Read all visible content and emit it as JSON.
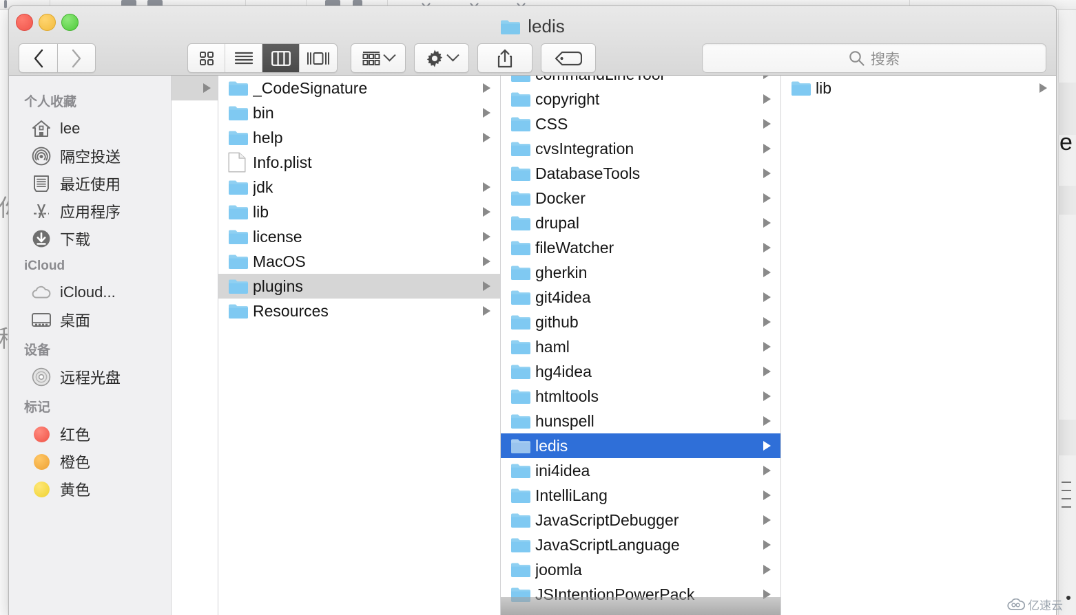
{
  "window": {
    "title": "ledis",
    "title_icon": "folder-icon",
    "traffic_lights": [
      {
        "name": "close",
        "color": "#f0554c"
      },
      {
        "name": "minimize",
        "color": "#f2bb3d"
      },
      {
        "name": "zoom",
        "color": "#4fc93b"
      }
    ]
  },
  "toolbar": {
    "back_label": "‹",
    "forward_label": "›",
    "view_modes": [
      {
        "name": "icon-view",
        "icon": "grid-icon",
        "active": false
      },
      {
        "name": "list-view",
        "icon": "list-icon",
        "active": false
      },
      {
        "name": "column-view",
        "icon": "columns-icon",
        "active": true
      },
      {
        "name": "gallery-view",
        "icon": "gallery-icon",
        "active": false
      }
    ],
    "arrange": {
      "icon": "arrange-icon",
      "chevron": "chevron-down-icon"
    },
    "action": {
      "icon": "gear-icon",
      "chevron": "chevron-down-icon"
    },
    "share": {
      "icon": "share-icon"
    },
    "tags": {
      "icon": "tag-icon"
    }
  },
  "search": {
    "icon": "search-icon",
    "placeholder": "搜索",
    "value": ""
  },
  "sidebar": {
    "sections": [
      {
        "header": "个人收藏",
        "items": [
          {
            "label": "lee",
            "icon": "home-icon"
          },
          {
            "label": "隔空投送",
            "icon": "airdrop-icon"
          },
          {
            "label": "最近使用",
            "icon": "recents-icon"
          },
          {
            "label": "应用程序",
            "icon": "applications-icon"
          },
          {
            "label": "下载",
            "icon": "downloads-icon"
          }
        ]
      },
      {
        "header": "iCloud",
        "items": [
          {
            "label": "iCloud...",
            "icon": "icloud-icon"
          },
          {
            "label": "桌面",
            "icon": "desktop-icon"
          }
        ]
      },
      {
        "header": "设备",
        "items": [
          {
            "label": "远程光盘",
            "icon": "remote-disc-icon"
          }
        ]
      },
      {
        "header": "标记",
        "items": [
          {
            "label": "红色",
            "icon": "tag-dot-icon",
            "color": "#f05a50"
          },
          {
            "label": "橙色",
            "icon": "tag-dot-icon",
            "color": "#f2a33c"
          },
          {
            "label": "黄色",
            "icon": "tag-dot-icon",
            "color": "#f2d23c"
          }
        ]
      }
    ]
  },
  "columns": [
    {
      "name": "column-ancestor",
      "partial": true,
      "items": [
        {
          "label": "",
          "kind": "folder",
          "selected": true,
          "has_children": true
        }
      ]
    },
    {
      "name": "column-app-contents",
      "items": [
        {
          "label": "_CodeSignature",
          "kind": "folder",
          "has_children": true,
          "selected": false
        },
        {
          "label": "bin",
          "kind": "folder",
          "has_children": true,
          "selected": false
        },
        {
          "label": "help",
          "kind": "folder",
          "has_children": true,
          "selected": false
        },
        {
          "label": "Info.plist",
          "kind": "file",
          "has_children": false,
          "selected": false
        },
        {
          "label": "jdk",
          "kind": "folder",
          "has_children": true,
          "selected": false
        },
        {
          "label": "lib",
          "kind": "folder",
          "has_children": true,
          "selected": false
        },
        {
          "label": "license",
          "kind": "folder",
          "has_children": true,
          "selected": false
        },
        {
          "label": "MacOS",
          "kind": "folder",
          "has_children": true,
          "selected": false
        },
        {
          "label": "plugins",
          "kind": "folder",
          "has_children": true,
          "selected": "gray"
        },
        {
          "label": "Resources",
          "kind": "folder",
          "has_children": true,
          "selected": false
        }
      ]
    },
    {
      "name": "column-plugins",
      "clipped_top": true,
      "items": [
        {
          "label": "commandLineTool",
          "kind": "folder",
          "has_children": true,
          "selected": false
        },
        {
          "label": "copyright",
          "kind": "folder",
          "has_children": true,
          "selected": false
        },
        {
          "label": "CSS",
          "kind": "folder",
          "has_children": true,
          "selected": false
        },
        {
          "label": "cvsIntegration",
          "kind": "folder",
          "has_children": true,
          "selected": false
        },
        {
          "label": "DatabaseTools",
          "kind": "folder",
          "has_children": true,
          "selected": false
        },
        {
          "label": "Docker",
          "kind": "folder",
          "has_children": true,
          "selected": false
        },
        {
          "label": "drupal",
          "kind": "folder",
          "has_children": true,
          "selected": false
        },
        {
          "label": "fileWatcher",
          "kind": "folder",
          "has_children": true,
          "selected": false
        },
        {
          "label": "gherkin",
          "kind": "folder",
          "has_children": true,
          "selected": false
        },
        {
          "label": "git4idea",
          "kind": "folder",
          "has_children": true,
          "selected": false
        },
        {
          "label": "github",
          "kind": "folder",
          "has_children": true,
          "selected": false
        },
        {
          "label": "haml",
          "kind": "folder",
          "has_children": true,
          "selected": false
        },
        {
          "label": "hg4idea",
          "kind": "folder",
          "has_children": true,
          "selected": false
        },
        {
          "label": "htmltools",
          "kind": "folder",
          "has_children": true,
          "selected": false
        },
        {
          "label": "hunspell",
          "kind": "folder",
          "has_children": true,
          "selected": false
        },
        {
          "label": "ledis",
          "kind": "folder",
          "has_children": true,
          "selected": "blue"
        },
        {
          "label": "ini4idea",
          "kind": "folder",
          "has_children": true,
          "selected": false
        },
        {
          "label": "IntelliLang",
          "kind": "folder",
          "has_children": true,
          "selected": false
        },
        {
          "label": "JavaScriptDebugger",
          "kind": "folder",
          "has_children": true,
          "selected": false
        },
        {
          "label": "JavaScriptLanguage",
          "kind": "folder",
          "has_children": true,
          "selected": false
        },
        {
          "label": "joomla",
          "kind": "folder",
          "has_children": true,
          "selected": false
        },
        {
          "label": "JSIntentionPowerPack",
          "kind": "folder",
          "has_children": true,
          "selected": false
        }
      ]
    },
    {
      "name": "column-ledis",
      "items": [
        {
          "label": "lib",
          "kind": "folder",
          "has_children": true,
          "selected": false
        }
      ]
    }
  ],
  "background": {
    "right_edge_text": "e",
    "left_edge_glyphs": [
      "你",
      "稍"
    ]
  },
  "watermark": {
    "text": "亿速云",
    "icon": "cloud-logo-icon",
    "color": "#9aa3ad"
  },
  "colors": {
    "selection_active": "#2f6fd8",
    "selection_inactive": "#d6d6d6",
    "folder_blue": "#7fc9f2",
    "sidebar_bg": "#f0f0f2",
    "titlebar_bg": "#e3e3e3"
  }
}
